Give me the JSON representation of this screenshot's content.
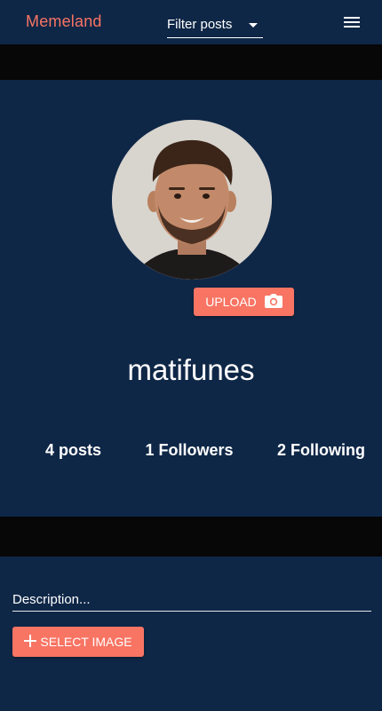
{
  "app": {
    "brand": "Memeland",
    "filter_label": "Filter posts",
    "menu_icon": "hamburger-menu-icon"
  },
  "profile": {
    "username": "matifunes",
    "upload_label": "UPLOAD",
    "upload_icon": "camera-icon",
    "stats": {
      "posts": "4 posts",
      "followers": "1 Followers",
      "following": "2 Following"
    }
  },
  "post_form": {
    "description_placeholder": "Description...",
    "select_image_label": "SELECT IMAGE",
    "select_image_icon": "plus-icon"
  },
  "colors": {
    "background": "#0f2747",
    "band": "#070707",
    "accent": "#f87463",
    "text": "#ffffff"
  }
}
